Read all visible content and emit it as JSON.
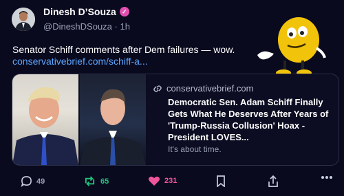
{
  "author": {
    "name": "Dinesh D’Souza",
    "handle": "@DineshDSouza",
    "separator": "·",
    "time": "1h"
  },
  "post": {
    "text": "Senator Schiff comments after Dem failures — wow.",
    "link": "conservativebrief.com/schiff-a..."
  },
  "card": {
    "domain": "conservativebrief.com",
    "title": "Democratic Sen. Adam Schiff Finally Gets What He Deserves After Years of 'Trump-Russia Collusion' Hoax - President LOVES...",
    "description": "It's about time."
  },
  "actions": {
    "replies": "49",
    "reposts": "65",
    "likes": "231"
  },
  "colors": {
    "background": "#0a0a1f",
    "link": "#5aa7ff",
    "repost": "#21c17a",
    "like": "#f0559a",
    "verified": "#e04fb0"
  },
  "icons": [
    "verified-icon",
    "link-icon",
    "reply-icon",
    "repost-icon",
    "like-icon",
    "bookmark-icon",
    "share-icon",
    "more-icon"
  ]
}
